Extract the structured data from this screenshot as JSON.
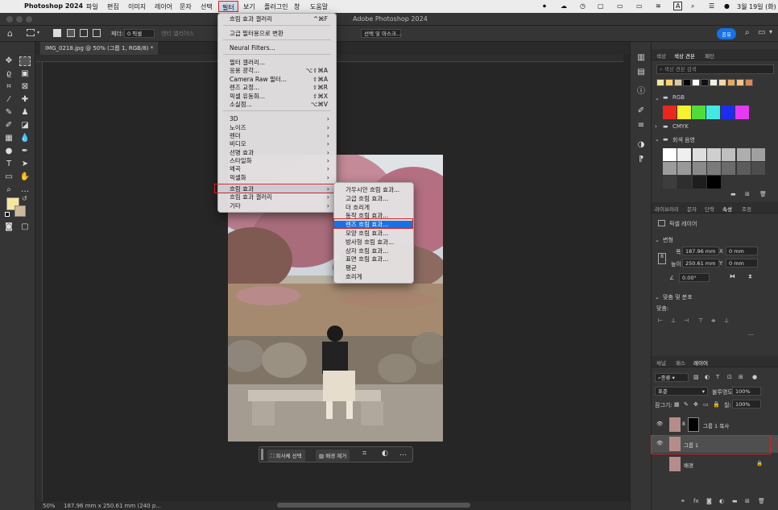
{
  "menubar": {
    "app": "Photoshop 2024",
    "items": [
      "파일",
      "편집",
      "이미지",
      "레이어",
      "문자",
      "선택",
      "필터",
      "보기",
      "플러그인",
      "창",
      "도움말"
    ],
    "datetime": "3월 19일 (화)"
  },
  "titlebar": {
    "title": "Adobe Photoshop 2024"
  },
  "options": {
    "feather_label": "페더:",
    "feather_value": "0 픽셀",
    "antialias": "앤티 앨리어스",
    "select_mask": "선택 및 마스크...",
    "share": "공유"
  },
  "document": {
    "tab": "IMG_0218.jpg @ 50% (그룹 1, RGB/8) *",
    "zoom": "50%",
    "size": "187.96 mm x 250.61 mm (240 p..."
  },
  "filter_menu": {
    "items": [
      {
        "label": "흐림 효과 갤러리",
        "shortcut": "^⌘F"
      },
      {
        "label": "고급 필터용으로 변환",
        "shortcut": ""
      },
      {
        "label": "Neural Filters...",
        "shortcut": ""
      },
      {
        "label": "필터 갤러리...",
        "shortcut": ""
      },
      {
        "label": "응용 광각...",
        "shortcut": "⌥⇧⌘A"
      },
      {
        "label": "Camera Raw 필터...",
        "shortcut": "⇧⌘A"
      },
      {
        "label": "렌즈 교정...",
        "shortcut": "⇧⌘R"
      },
      {
        "label": "픽셀 유동화...",
        "shortcut": "⇧⌘X"
      },
      {
        "label": "소실점...",
        "shortcut": "⌥⌘V"
      },
      {
        "label": "3D",
        "shortcut": ""
      },
      {
        "label": "노이즈",
        "shortcut": ""
      },
      {
        "label": "렌더",
        "shortcut": ""
      },
      {
        "label": "비디오",
        "shortcut": ""
      },
      {
        "label": "선명 효과",
        "shortcut": ""
      },
      {
        "label": "스타일화",
        "shortcut": ""
      },
      {
        "label": "왜곡",
        "shortcut": ""
      },
      {
        "label": "픽셀화",
        "shortcut": ""
      },
      {
        "label": "흐림 효과",
        "shortcut": ""
      },
      {
        "label": "흐림 효과 갤러리",
        "shortcut": ""
      },
      {
        "label": "기타",
        "shortcut": ""
      }
    ]
  },
  "blur_submenu": {
    "items": [
      "가우시안 흐림 효과...",
      "고급 흐림 효과...",
      "더 흐리게",
      "동작 흐림 효과...",
      "렌즈 흐림 효과...",
      "모양 흐림 효과...",
      "방사형 흐림 효과...",
      "상자 흐림 효과...",
      "표면 흐림 효과...",
      "평균",
      "흐리게"
    ],
    "selected": "렌즈 흐림 효과..."
  },
  "contextbar": {
    "select_subject": "피사체 선택",
    "remove_bg": "배경 제거"
  },
  "color_panel": {
    "tabs": [
      "색상",
      "색상 견본",
      "패턴"
    ],
    "search_placeholder": "색상 견본 검색",
    "recent_swatches": [
      "#f3e6a7",
      "#f7d36b",
      "#d6cba8",
      "#000000",
      "#ffffff",
      "#111111",
      "#f3efe4",
      "#f0d8a8",
      "#e8a85f",
      "#f1c491",
      "#d98a5a"
    ],
    "group_rgb": "RGB",
    "rgb_swatches": [
      "#e8281e",
      "#f8f22e",
      "#50dd3c",
      "#43e8e3",
      "#1b2df0",
      "#e43af0"
    ],
    "group_cmyk": "CMYK",
    "group_gray": "회색 음영",
    "gray_swatches": [
      "#ffffff",
      "#efefef",
      "#dedede",
      "#cfcfcf",
      "#bfbfbf",
      "#aeaeae",
      "#a0a0a0",
      "#9c9c9c",
      "#999999",
      "#8a8a8a",
      "#7a7a7a",
      "#6b6b6b",
      "#5c5c5c",
      "#4c4c4c",
      "#3d3d3d",
      "#2e2e2e",
      "#1e1e1e",
      "#000000"
    ]
  },
  "properties_panel": {
    "tabs": [
      "라이브러리",
      "문자",
      "단락",
      "속성",
      "조정"
    ],
    "layer_type": "픽셀 레이어",
    "transform_title": "변형",
    "w_label": "폭",
    "w_value": "187.96 mm",
    "h_label": "높이",
    "h_value": "250.61 mm",
    "x_label": "X",
    "x_value": "0 mm",
    "y_label": "Y",
    "y_value": "0 mm",
    "angle": "0.00°",
    "align_title": "맞춤 및 분포",
    "align_label": "맞춤:"
  },
  "layers_panel": {
    "tabs": [
      "채널",
      "패스",
      "레이어"
    ],
    "kind": "종류",
    "blend": "표준",
    "opacity_label": "불투명도:",
    "opacity": "100%",
    "lock_label": "잠그기:",
    "fill_label": "칠:",
    "fill": "100%",
    "layers": [
      {
        "name": "그룹 1 복사",
        "selected": false
      },
      {
        "name": "그룹 1",
        "selected": true
      },
      {
        "name": "배경",
        "selected": false
      }
    ]
  },
  "colors": {
    "foreground": "#f5e79e",
    "background": "#cbb99a",
    "accent": "#1473e6",
    "highlight": "#d42424"
  }
}
